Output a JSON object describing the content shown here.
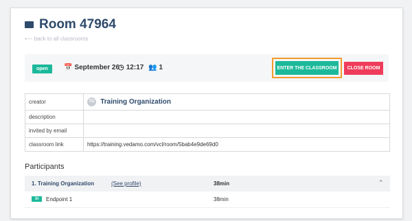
{
  "room": {
    "title": "Room 47964",
    "camera_icon": "video-camera-icon",
    "back_link": "⟵ back to all classrooms"
  },
  "status": {
    "badge": "open",
    "date_icon": "calendar-icon",
    "date": "September 26",
    "time_icon": "clock-icon",
    "time": "12:17",
    "users_icon": "users-icon",
    "users_count": "1",
    "enter_label": "ENTER THE CLASSROOM",
    "close_label": "CLOSE ROOM",
    "colors": {
      "primary": "#1bb99a",
      "danger": "#ef3c5b",
      "highlight": "#f39a2c"
    }
  },
  "details": {
    "rows": [
      {
        "key": "creator",
        "value": "Training Organization",
        "avatar": "TO"
      },
      {
        "key": "description",
        "value": ""
      },
      {
        "key": "invited by email",
        "value": ""
      },
      {
        "key": "classroom link",
        "value": "https://training.vedamo.com/vcl/room/5bab4e9de69d0"
      }
    ]
  },
  "participants": {
    "heading": "Participants",
    "items": [
      {
        "name": "1. Training Organization",
        "profile_link": "(See profile)",
        "duration": "38min",
        "endpoints": [
          {
            "badge": "in",
            "name": "Endpoint 1",
            "duration": "38min"
          }
        ]
      }
    ]
  }
}
